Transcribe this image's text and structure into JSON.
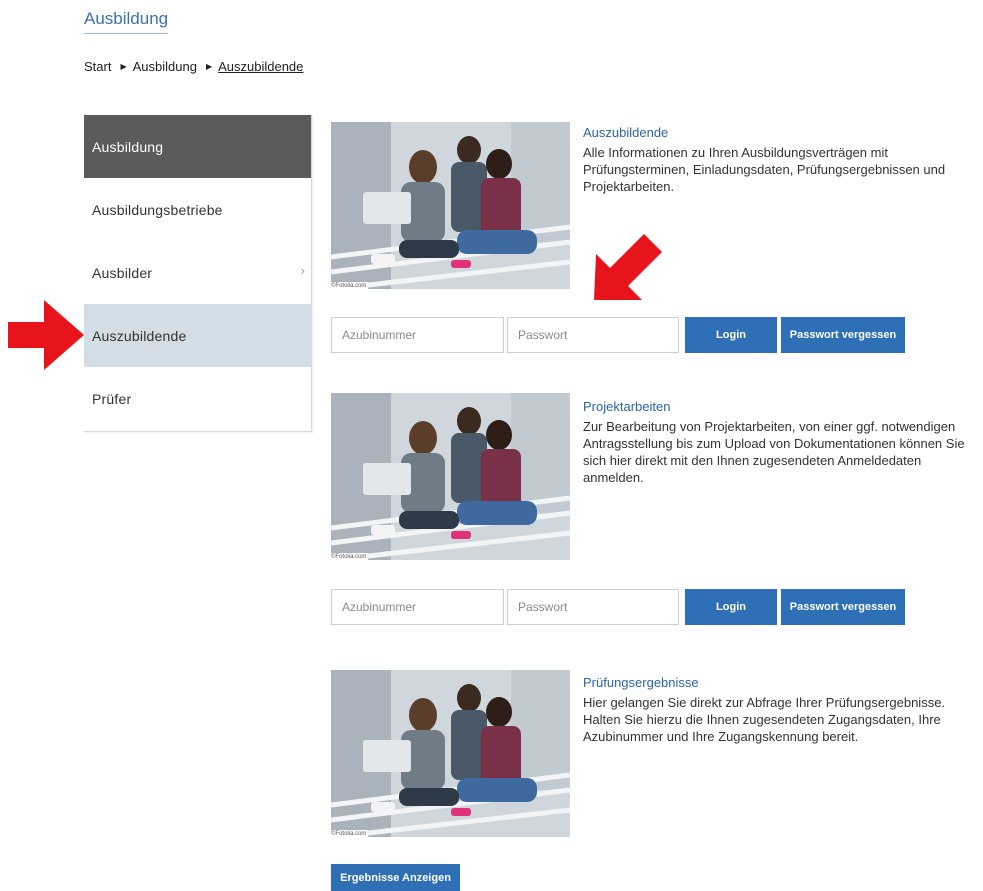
{
  "page": {
    "title": "Ausbildung"
  },
  "breadcrumb": [
    {
      "label": "Start"
    },
    {
      "label": "Ausbildung"
    },
    {
      "label": "Auszubildende"
    }
  ],
  "sidebar": {
    "items": [
      {
        "label": "Ausbildung"
      },
      {
        "label": "Ausbildungsbetriebe"
      },
      {
        "label": "Ausbilder",
        "chevron": "›"
      },
      {
        "label": "Auszubildende"
      },
      {
        "label": "Prüfer"
      }
    ]
  },
  "sections": [
    {
      "title": "Auszubildende",
      "text": "Alle Informationen zu Ihren Ausbildungsverträgen mit Prüfungsterminen, Einladungsdaten, Prüfungsergebnissen und Projektarbeiten.",
      "image_credit": "©Fotolia.com",
      "username_placeholder": "Azubinummer",
      "password_placeholder": "Passwort",
      "login_label": "Login",
      "forgot_label": "Passwort vergessen"
    },
    {
      "title": "Projektarbeiten",
      "text": "Zur Bearbeitung von Projektarbeiten, von einer ggf. notwendigen Antragsstellung bis zum Upload von Dokumentationen können Sie sich hier direkt mit den Ihnen zugesendeten Anmeldedaten anmelden.",
      "image_credit": "©Fotolia.com",
      "username_placeholder": "Azubinummer",
      "password_placeholder": "Passwort",
      "login_label": "Login",
      "forgot_label": "Passwort vergessen"
    },
    {
      "title": "Prüfungsergebnisse",
      "text": "Hier gelangen Sie direkt zur Abfrage Ihrer Prüfungsergebnisse. Halten Sie hierzu die Ihnen zugesendeten Zugangsdaten, Ihre Azubinummer und Ihre Zugangskennung bereit.",
      "image_credit": "©Fotolia.com",
      "results_label": "Ergebnisse Anzeigen"
    }
  ],
  "colors": {
    "accent_blue": "#2e6fb6",
    "sidebar_header": "#5b5b5b",
    "sidebar_selected": "#d3dde6",
    "annotation_red": "#e8141c"
  }
}
